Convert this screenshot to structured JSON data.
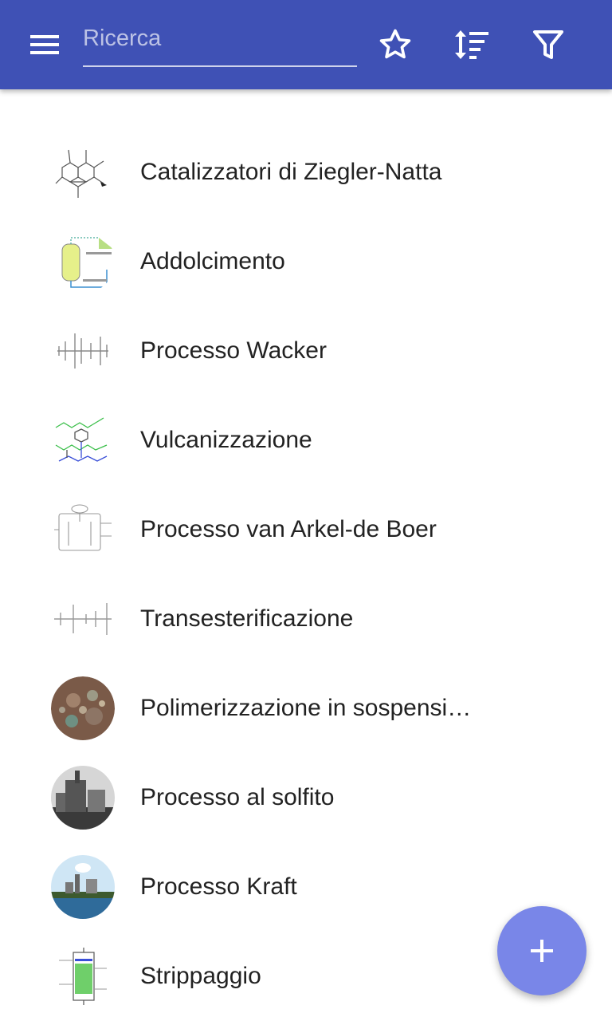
{
  "toolbar": {
    "search_placeholder": "Ricerca",
    "menu_icon": "menu-icon",
    "favorite_icon": "star-outline-icon",
    "sort_icon": "sort-icon",
    "filter_icon": "filter-icon"
  },
  "items": [
    {
      "label": "Catalizzatori di Ziegler-Natta",
      "thumb": "chemical-structure"
    },
    {
      "label": "Addolcimento",
      "thumb": "water-softener-diagram"
    },
    {
      "label": "Processo Wacker",
      "thumb": "reaction-scheme"
    },
    {
      "label": "Vulcanizzazione",
      "thumb": "polymer-structure"
    },
    {
      "label": "Processo van Arkel-de Boer",
      "thumb": "apparatus-drawing"
    },
    {
      "label": "Transesterificazione",
      "thumb": "reaction-scheme"
    },
    {
      "label": "Polimerizzazione in sospensione",
      "thumb": "microscope-photo"
    },
    {
      "label": "Processo al solfito",
      "thumb": "mill-photo"
    },
    {
      "label": "Processo Kraft",
      "thumb": "factory-photo"
    },
    {
      "label": "Strippaggio",
      "thumb": "column-diagram"
    }
  ],
  "fab": {
    "icon": "plus-icon"
  },
  "colors": {
    "primary": "#3f51b5",
    "accent": "#7986e8",
    "text": "#222222"
  }
}
